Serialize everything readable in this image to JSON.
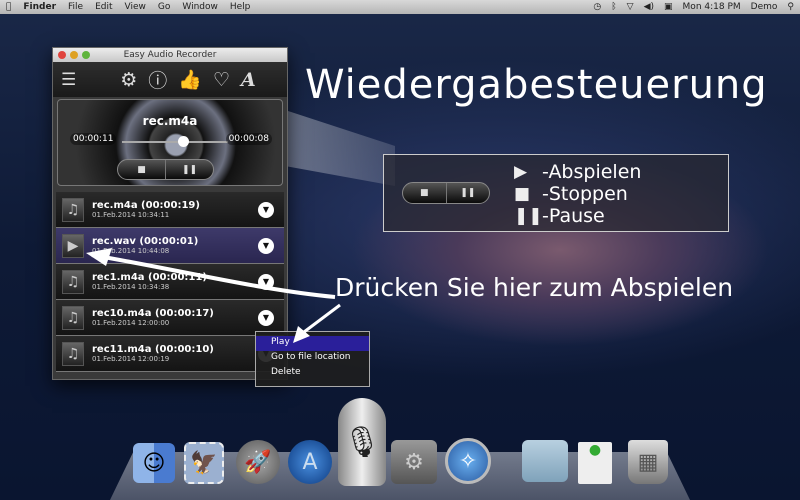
{
  "menubar": {
    "apple": "",
    "app": "Finder",
    "items": [
      "File",
      "Edit",
      "View",
      "Go",
      "Window",
      "Help"
    ],
    "clock": "Mon 4:18 PM",
    "user": "Demo"
  },
  "window": {
    "title": "Easy Audio Recorder",
    "player": {
      "file": "rec.m4a",
      "elapsed": "00:00:11",
      "remaining": "00:00:08",
      "progress": 0.58
    },
    "recordings": [
      {
        "name": "rec.m4a (00:00:19)",
        "date": "01.Feb.2014 10:34:11",
        "selected": false
      },
      {
        "name": "rec.wav (00:00:01)",
        "date": "01.Feb.2014 10:44:08",
        "selected": true
      },
      {
        "name": "rec1.m4a (00:00:11)",
        "date": "01.Feb.2014 10:34:38",
        "selected": false
      },
      {
        "name": "rec10.m4a (00:00:17)",
        "date": "01.Feb.2014 12:00:00",
        "selected": false
      },
      {
        "name": "rec11.m4a (00:00:10)",
        "date": "01.Feb.2014 12:00:19",
        "selected": false
      }
    ]
  },
  "context_menu": {
    "items": [
      "Play",
      "Go to file location",
      "Delete"
    ],
    "highlighted": "Play"
  },
  "heading": "Wiedergabesteuerung",
  "legend": [
    {
      "icon": "play-icon",
      "label": "-Abspielen"
    },
    {
      "icon": "stop-icon",
      "label": "-Stoppen"
    },
    {
      "icon": "pause-icon",
      "label": "-Pause"
    }
  ],
  "hint": "Drücken Sie hier zum Abspielen",
  "dock": [
    "finder",
    "mail",
    "launchpad",
    "app-store",
    "easy-audio-recorder",
    "system-preferences",
    "safari",
    "documents",
    "downloads",
    "trash"
  ]
}
